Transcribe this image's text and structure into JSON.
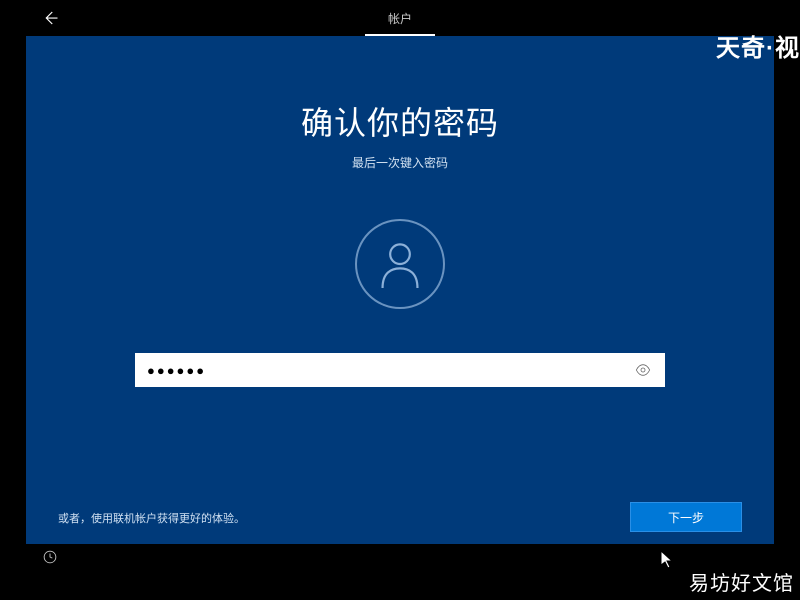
{
  "topbar": {
    "tab_label": "帐户"
  },
  "main": {
    "title": "确认你的密码",
    "subtitle": "最后一次键入密码",
    "password_value": "●●●●●●"
  },
  "footer": {
    "hint": "或者，使用联机帐户获得更好的体验。",
    "next_label": "下一步"
  },
  "watermarks": {
    "top_right": "天奇·视",
    "bottom_right": "易坊好文馆"
  }
}
